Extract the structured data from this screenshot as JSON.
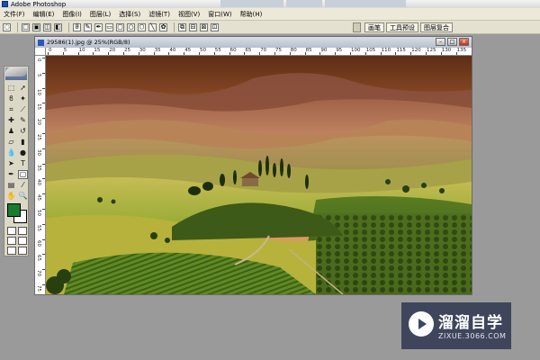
{
  "window": {
    "title": "Adobe Photoshop"
  },
  "menu": [
    "文件(F)",
    "编辑(E)",
    "图像(I)",
    "图层(L)",
    "选择(S)",
    "滤镜(T)",
    "视图(V)",
    "窗口(W)",
    "帮助(H)"
  ],
  "palette_well": {
    "tabs": [
      "画笔",
      "工具预设",
      "图层复合"
    ]
  },
  "document": {
    "title": "29586(1).jpg @ 25%(RGB/8)",
    "ruler_top": [
      "0",
      "5",
      "10",
      "15",
      "20",
      "25",
      "30",
      "35",
      "40",
      "45",
      "50",
      "55",
      "60",
      "65",
      "70",
      "75",
      "80",
      "85",
      "90",
      "95",
      "100",
      "105",
      "110",
      "115",
      "120",
      "125",
      "130",
      "135"
    ],
    "ruler_left": [
      "0",
      "5",
      "10",
      "15",
      "20",
      "25",
      "30",
      "35",
      "40",
      "45",
      "50",
      "55",
      "60",
      "65",
      "70",
      "75"
    ]
  },
  "colors": {
    "foreground": "#1a7a2e",
    "background": "#ffffff"
  },
  "watermark": {
    "brand": "溜溜自学",
    "url": "ZIXUE.3066.COM"
  }
}
